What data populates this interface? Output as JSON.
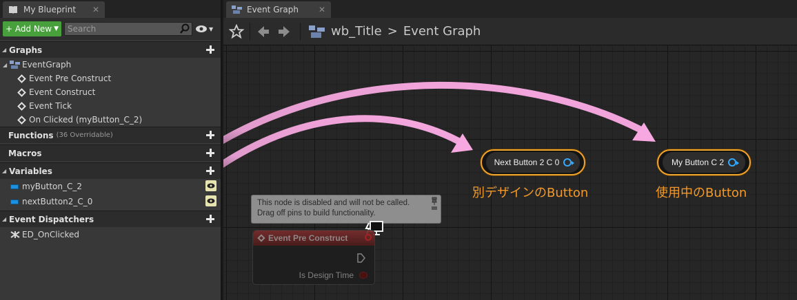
{
  "left_panel": {
    "tab_title": "My Blueprint",
    "tab_close": "✕",
    "add_new_label": "+ Add New",
    "search_placeholder": "Search",
    "sections": {
      "graphs": "Graphs",
      "functions": "Functions",
      "functions_sub": "(36 Overridable)",
      "macros": "Macros",
      "variables": "Variables",
      "dispatchers": "Event Dispatchers"
    },
    "graph_root": "EventGraph",
    "graph_items": [
      "Event Pre Construct",
      "Event Construct",
      "Event Tick",
      "On Clicked (myButton_C_2)"
    ],
    "variables": [
      "myButton_C_2",
      "nextButton2_C_0"
    ],
    "dispatchers": [
      "ED_OnClicked"
    ]
  },
  "graph_tab": {
    "title": "Event Graph",
    "close": "✕"
  },
  "breadcrumb": {
    "blueprint": "wb_Title",
    "separator": ">",
    "graph": "Event Graph"
  },
  "graph": {
    "node_next": "Next Button 2 C 0",
    "node_my": "My Button C 2",
    "label_next": "別デザインのButton",
    "label_my": "使用中のButton",
    "tooltip_line1": "This node is disabled and will not be called.",
    "tooltip_line2": "Drag off pins to build functionality.",
    "disabled_node_title": "Event Pre Construct",
    "disabled_node_pin": "Is Design Time"
  },
  "colors": {
    "accent_orange": "#f1a52a",
    "arrow_pink": "#f7a8e0",
    "add_green": "#47a03b"
  }
}
